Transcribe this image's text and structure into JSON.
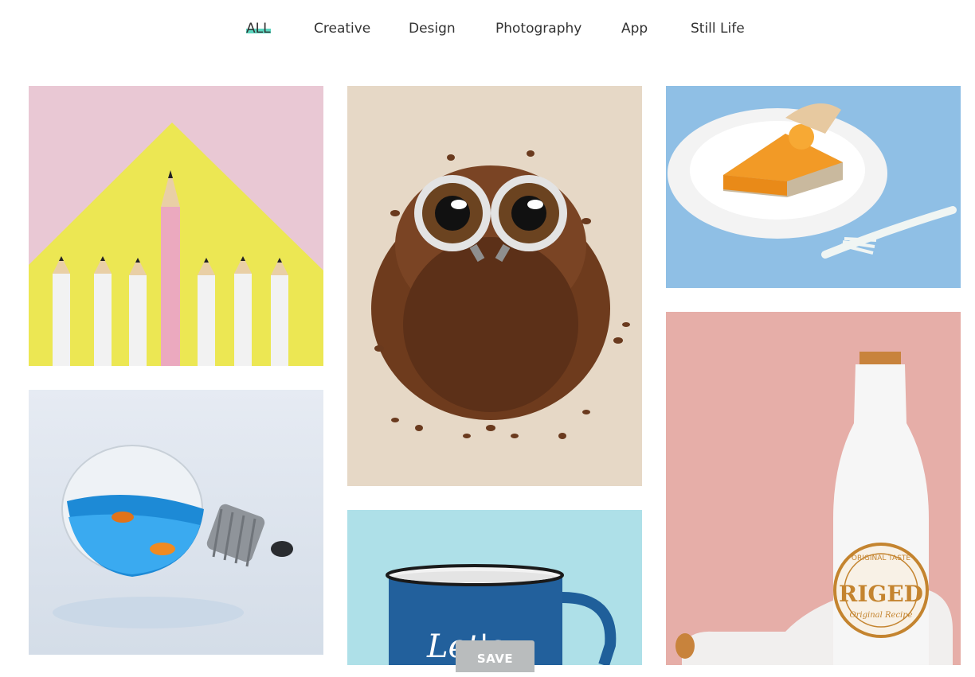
{
  "filters": {
    "items": [
      {
        "label": "ALL",
        "active": true
      },
      {
        "label": "Creative"
      },
      {
        "label": "Design"
      },
      {
        "label": "Photography"
      },
      {
        "label": "App"
      },
      {
        "label": "Still Life"
      }
    ]
  },
  "accent_color": "#5ad6bf",
  "gallery": {
    "tiles": [
      {
        "name": "pencils-photo",
        "subject": "pencils on pink and yellow"
      },
      {
        "name": "coffee-owl-photo",
        "subject": "coffee bean owl"
      },
      {
        "name": "pie-slice-photo",
        "subject": "pie slice on plate"
      },
      {
        "name": "fish-bulb-photo",
        "subject": "goldfish in light bulb"
      },
      {
        "name": "mug-photo",
        "subject": "blue enamel mug"
      },
      {
        "name": "bottle-photo",
        "subject": "white beer bottles"
      }
    ],
    "mug_text": "Let's",
    "bottle_brand": "RIGED",
    "bottle_tagline": "Original Recipe",
    "bottle_ring": "ORIGINAL TASTE"
  },
  "save_button": {
    "label": "SAVE"
  }
}
